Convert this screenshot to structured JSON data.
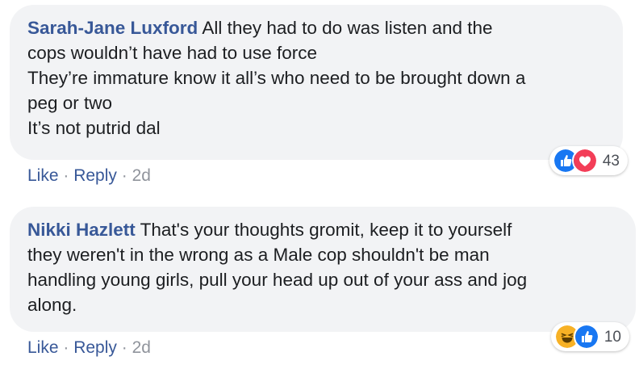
{
  "comments": [
    {
      "author": "Sarah-Jane Luxford",
      "lines": [
        "All they had to do was listen and the",
        "cops wouldn’t have had to use force",
        "They’re immature know it all’s who need to be brought down a",
        "peg or two",
        "It’s not putrid dal"
      ],
      "actions": {
        "like": "Like",
        "sep": " · ",
        "reply": "Reply",
        "time": "2d"
      },
      "reactions": {
        "icons": [
          "like-icon",
          "love-icon"
        ],
        "count": "43"
      }
    },
    {
      "author": "Nikki Hazlett",
      "lines": [
        "That's your thoughts gromit, keep it to yourself",
        "they weren't in the wrong as a Male cop shouldn't be man",
        "handling young girls, pull your head up out of your ass and jog",
        "along."
      ],
      "actions": {
        "like": "Like",
        "sep": " · ",
        "reply": "Reply",
        "time": "2d"
      },
      "reactions": {
        "icons": [
          "haha-icon",
          "like-icon"
        ],
        "count": "10"
      }
    }
  ],
  "colors": {
    "author": "#385898",
    "bubble": "#f2f3f5",
    "like": "#1877f2",
    "love": "#f33e58",
    "haha": "#f7b125"
  }
}
